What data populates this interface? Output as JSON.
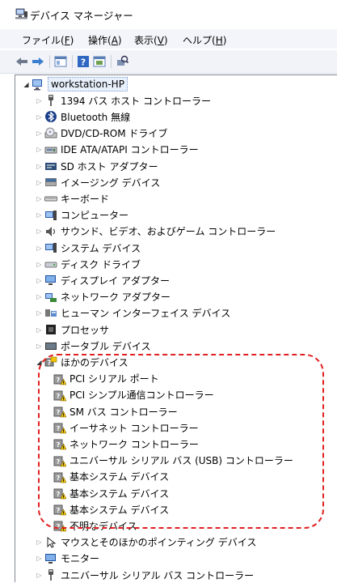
{
  "window": {
    "title": "デバイス マネージャー"
  },
  "menu": [
    {
      "label": "ファイル(",
      "accel": "F",
      "tail": ")"
    },
    {
      "label": "操作(",
      "accel": "A",
      "tail": ")"
    },
    {
      "label": "表示(",
      "accel": "V",
      "tail": ")"
    },
    {
      "label": "ヘルプ(",
      "accel": "H",
      "tail": ")"
    }
  ],
  "toolbar": {
    "buttons": [
      "back-arrow-icon",
      "forward-arrow-icon",
      "properties-icon",
      "help-icon",
      "update-driver-icon",
      "scan-hardware-icon"
    ]
  },
  "tree": {
    "root": "workstation-HP",
    "categories": [
      {
        "label": "1394 バス ホスト コントローラー",
        "icon": "1394-controller-icon"
      },
      {
        "label": "Bluetooth 無線",
        "icon": "bluetooth-icon"
      },
      {
        "label": "DVD/CD-ROM ドライブ",
        "icon": "dvd-drive-icon"
      },
      {
        "label": "IDE ATA/ATAPI コントローラー",
        "icon": "ide-controller-icon"
      },
      {
        "label": "SD ホスト アダプター",
        "icon": "sd-host-adapter-icon"
      },
      {
        "label": "イメージング デバイス",
        "icon": "imaging-device-icon"
      },
      {
        "label": "キーボード",
        "icon": "keyboard-icon"
      },
      {
        "label": "コンピューター",
        "icon": "computer-icon"
      },
      {
        "label": "サウンド、ビデオ、およびゲーム コントローラー",
        "icon": "sound-icon"
      },
      {
        "label": "システム デバイス",
        "icon": "system-device-icon"
      },
      {
        "label": "ディスク ドライブ",
        "icon": "disk-drive-icon"
      },
      {
        "label": "ディスプレイ アダプター",
        "icon": "display-adapter-icon"
      },
      {
        "label": "ネットワーク アダプター",
        "icon": "network-adapter-icon"
      },
      {
        "label": "ヒューマン インターフェイス デバイス",
        "icon": "hid-icon"
      },
      {
        "label": "プロセッサ",
        "icon": "processor-icon"
      },
      {
        "label": "ポータブル デバイス",
        "icon": "portable-device-icon"
      }
    ],
    "other_devices": {
      "label": "ほかのデバイス",
      "icon": "other-devices-icon",
      "children": [
        "PCI シリアル ポート",
        "PCI シンプル通信コントローラー",
        "SM バス コントローラー",
        "イーサネット コントローラー",
        "ネットワーク コントローラー",
        "ユニバーサル シリアル バス (USB) コントローラー",
        "基本システム デバイス",
        "基本システム デバイス",
        "基本システム デバイス",
        "不明なデバイス"
      ]
    },
    "after": [
      {
        "label": "マウスとそのほかのポインティング デバイス",
        "icon": "mouse-icon"
      },
      {
        "label": "モニター",
        "icon": "monitor-icon"
      },
      {
        "label": "ユニバーサル シリアル バス コントローラー",
        "icon": "usb-controller-icon"
      }
    ]
  },
  "colors": {
    "menubar": "#f3f5fa",
    "highlight_box": "#e02020",
    "warning": "#f2c500"
  }
}
